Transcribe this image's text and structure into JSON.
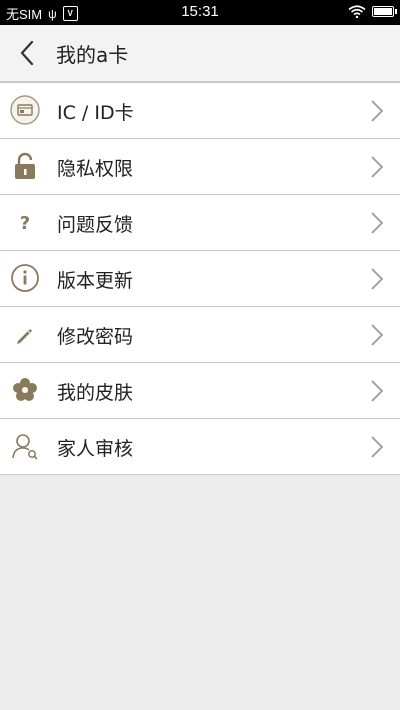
{
  "status_bar": {
    "carrier": "无SIM",
    "usb_symbol": "ψ",
    "volte_symbol": "V",
    "time": "15:31"
  },
  "header": {
    "title": "我的a卡"
  },
  "menu": {
    "items": [
      {
        "label": "IC / ID卡",
        "icon": "id-card-icon"
      },
      {
        "label": "隐私权限",
        "icon": "lock-icon"
      },
      {
        "label": "问题反馈",
        "icon": "question-icon"
      },
      {
        "label": "版本更新",
        "icon": "info-icon"
      },
      {
        "label": "修改密码",
        "icon": "pencil-icon"
      },
      {
        "label": "我的皮肤",
        "icon": "flower-icon"
      },
      {
        "label": "家人审核",
        "icon": "user-search-icon"
      }
    ]
  },
  "colors": {
    "accent": "#8a7a5c",
    "header_bg": "#f3f3f3",
    "page_bg": "#ececec"
  }
}
